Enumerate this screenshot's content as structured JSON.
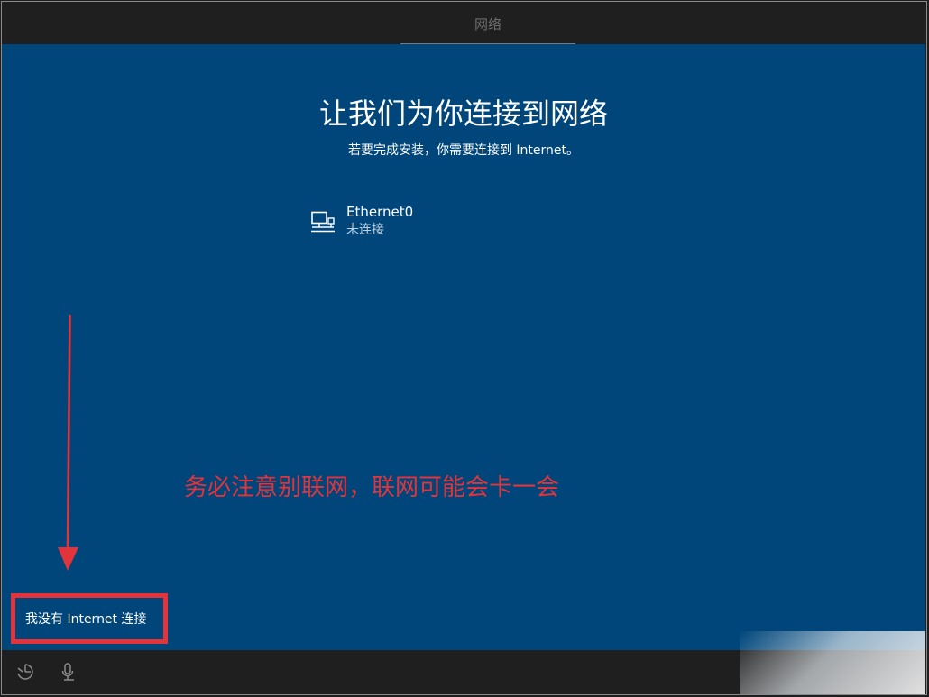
{
  "header": {
    "tab_label": "网络"
  },
  "main": {
    "title": "让我们为你连接到网络",
    "subtitle": "若要完成安装，你需要连接到 Internet。",
    "network": {
      "name": "Ethernet0",
      "status": "未连接",
      "icon": "ethernet-icon"
    }
  },
  "annotation": {
    "text": "务必注意别联网，联网可能会卡一会",
    "color": "#e3343b"
  },
  "no_internet_link": "我没有 Internet 连接",
  "bottom_bar": {
    "icons": [
      "ease-of-access-icon",
      "microphone-icon"
    ]
  },
  "colors": {
    "background": "#00467a",
    "bar": "#1f1f1f",
    "highlight": "#e3343b"
  }
}
